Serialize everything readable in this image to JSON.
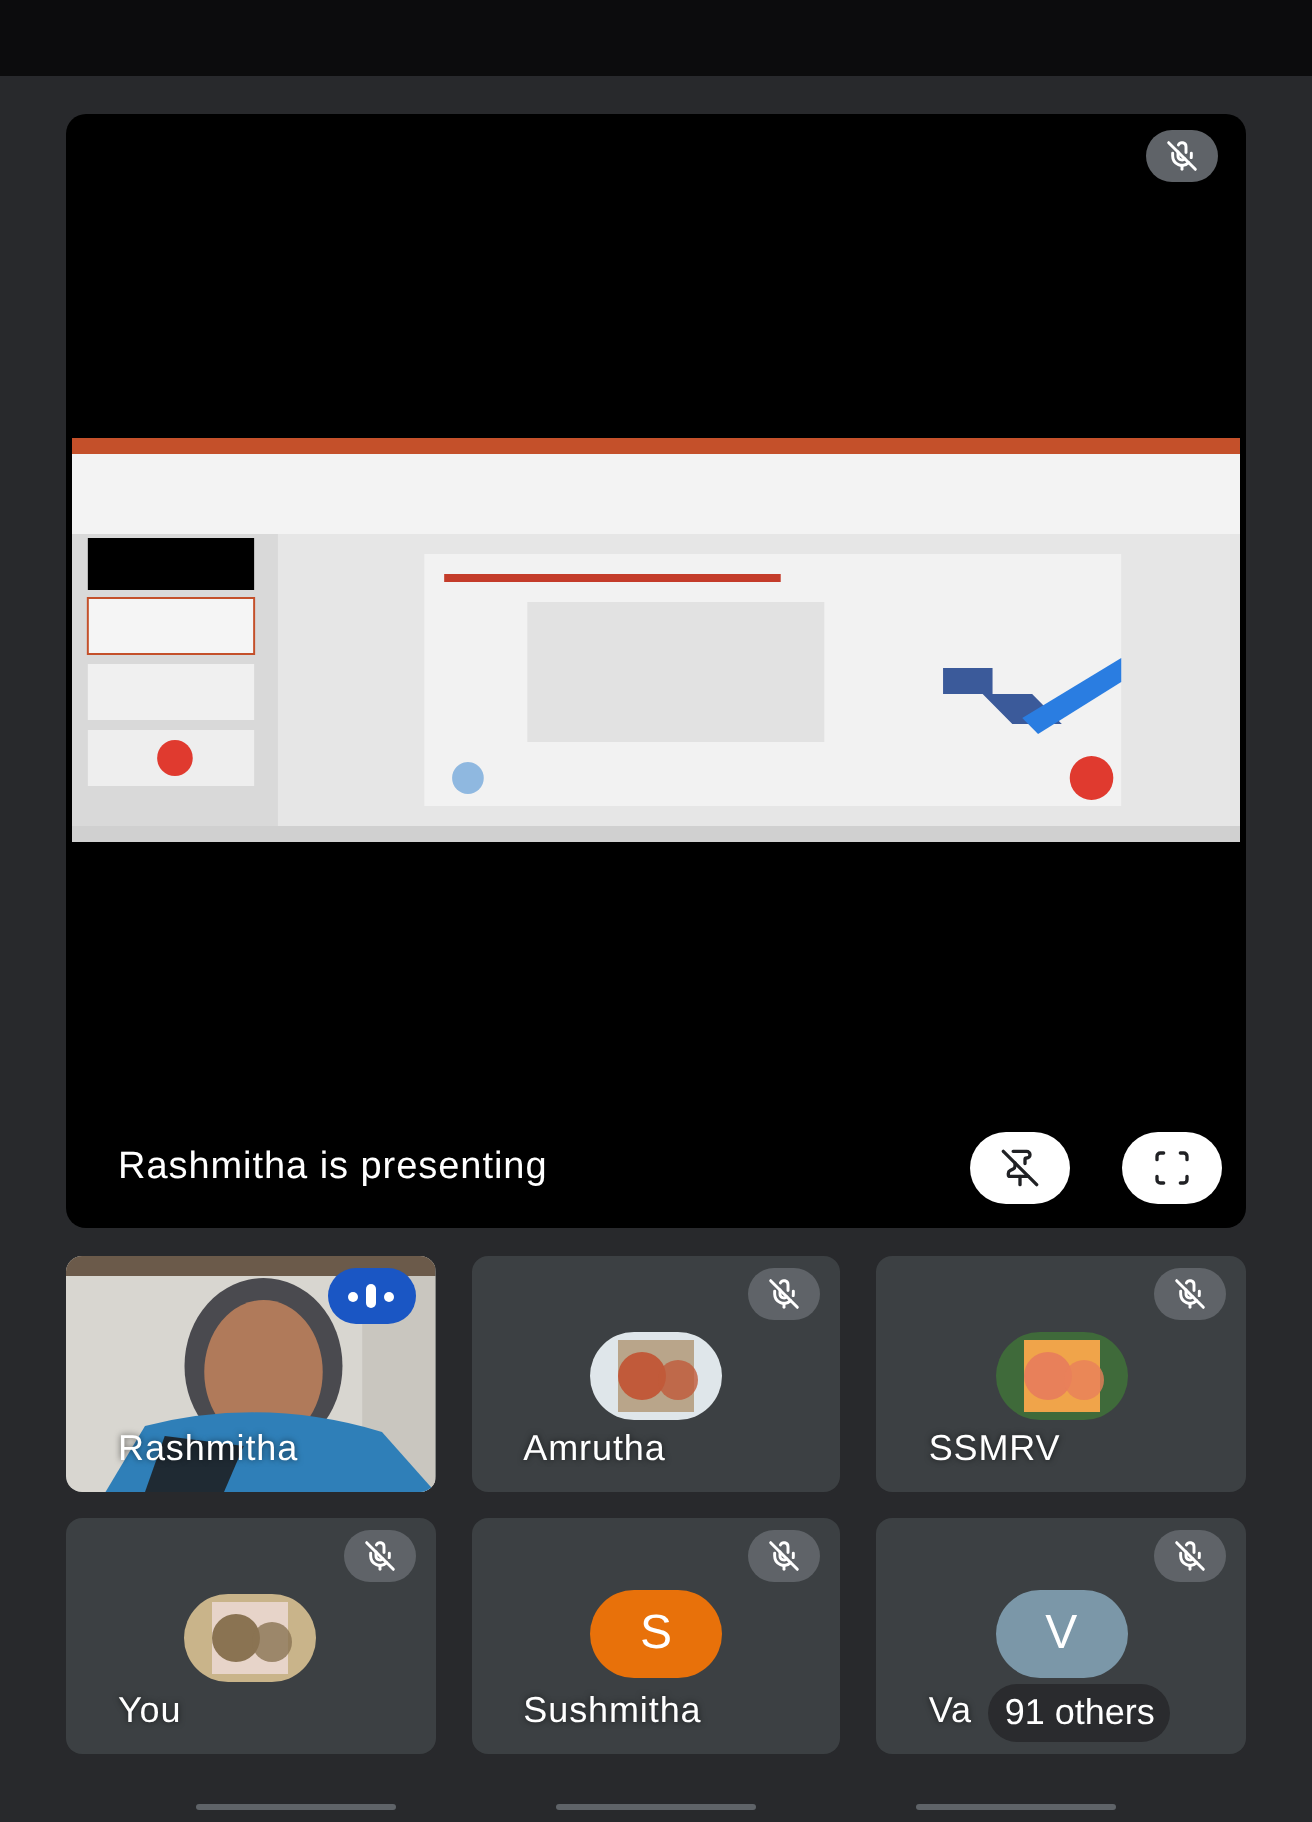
{
  "presentation": {
    "caption": "Rashmitha is presenting",
    "muted": true
  },
  "participants": [
    {
      "name": "Rashmitha",
      "kind": "video",
      "muted": false
    },
    {
      "name": "Amrutha",
      "muted": true
    },
    {
      "name": "SSMRV",
      "muted": true
    },
    {
      "name": "You",
      "muted": true
    },
    {
      "name": "Sushmitha",
      "kind": "initial",
      "initial": "S",
      "color": "#e8710a",
      "muted": true
    },
    {
      "name": "Va",
      "kind": "initial",
      "initial": "V",
      "color": "#7b97a8",
      "muted": true
    }
  ],
  "others": "91 others"
}
